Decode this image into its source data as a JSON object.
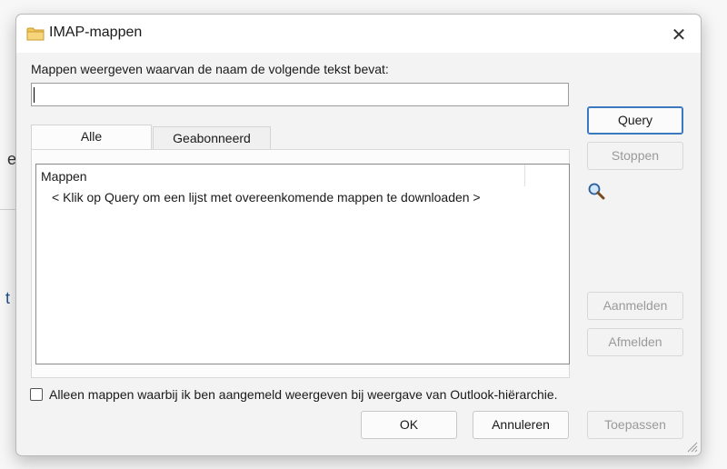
{
  "background": {
    "fragment_1": "e",
    "fragment_2": "t"
  },
  "dialog": {
    "title": "IMAP-mappen",
    "title_icon": "folder-icon",
    "close_icon": "close-icon",
    "close_glyph": "✕"
  },
  "search": {
    "label": "Mappen weergeven waarvan de naam de volgende tekst bevat:",
    "value": ""
  },
  "tabs": [
    {
      "label": "Alle",
      "active": true
    },
    {
      "label": "Geabonneerd",
      "active": false
    }
  ],
  "list": {
    "column_header": "Mappen",
    "message": "< Klik op Query om een lijst met overeenkomende mappen te downloaden >"
  },
  "side_buttons": {
    "query": "Query",
    "stop": "Stoppen",
    "subscribe": "Aanmelden",
    "unsubscribe": "Afmelden"
  },
  "checkbox": {
    "label": "Alleen mappen waarbij ik ben aangemeld weergeven bij weergave van Outlook-hiërarchie.",
    "checked": false
  },
  "footer_buttons": {
    "ok": "OK",
    "cancel": "Annuleren",
    "apply": "Toepassen"
  },
  "colors": {
    "accent": "#3a78c0",
    "dialog_bg": "#f3f3f3",
    "disabled_text": "#9a9a9a"
  }
}
